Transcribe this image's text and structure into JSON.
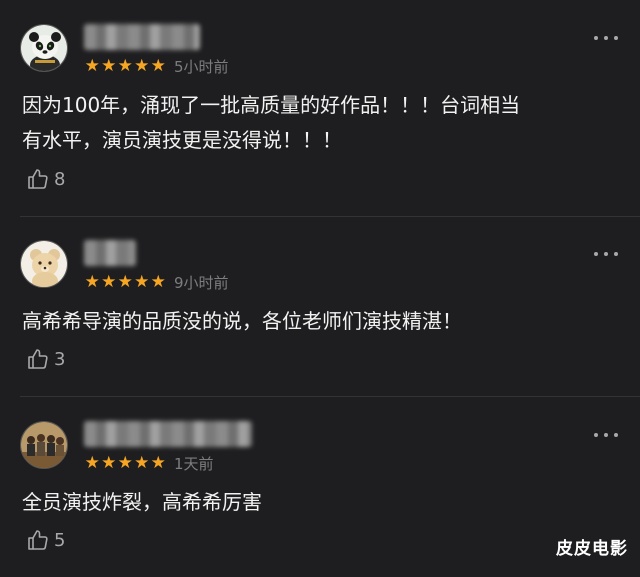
{
  "comments": [
    {
      "rating_stars": 5,
      "time": "5小时前",
      "text": "因为100年，涌现了一批高质量的好作品！！！台词相当\n有水平，演员演技更是没得说！！！",
      "likes": "8",
      "avatar_icon": "panda-avatar-icon"
    },
    {
      "rating_stars": 5,
      "time": "9小时前",
      "text": "高希希导演的品质没的说，各位老师们演技精湛！",
      "likes": "3",
      "avatar_icon": "teddy-bear-avatar-icon"
    },
    {
      "rating_stars": 5,
      "time": "1天前",
      "text": "全员演技炸裂，高希希厉害",
      "likes": "5",
      "avatar_icon": "group-photo-avatar-icon"
    }
  ],
  "star_glyph": "★",
  "watermark": "皮皮电影",
  "colors": {
    "background": "#1e1e20",
    "star": "#f6a623",
    "secondary_text": "#7d7d80",
    "primary_text": "#f2f2f2"
  }
}
